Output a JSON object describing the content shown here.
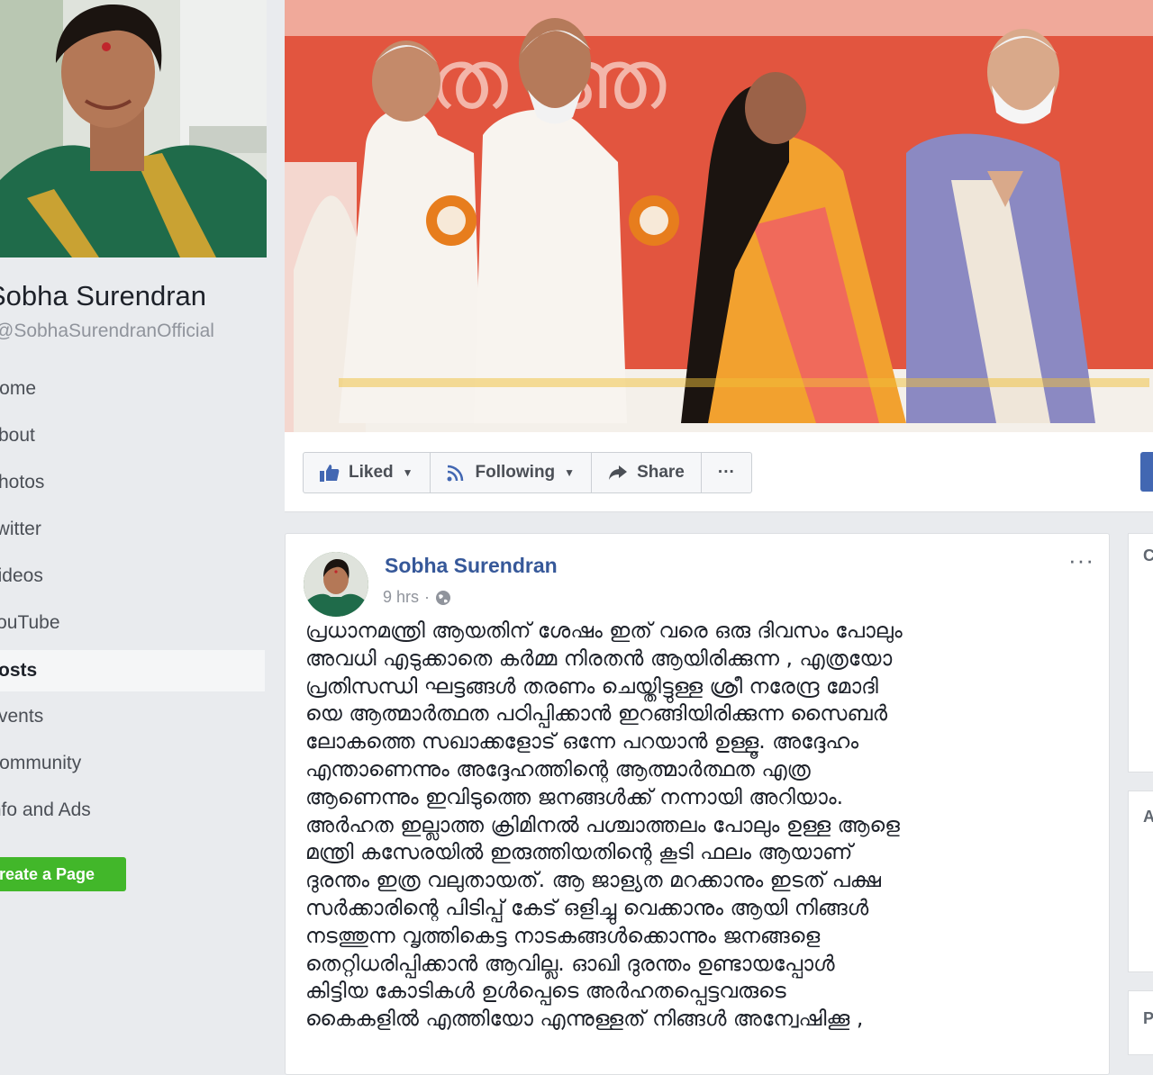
{
  "page": {
    "name": "Sobha Surendran",
    "handle": "@SobhaSurendranOfficial"
  },
  "nav": {
    "items": [
      "Home",
      "About",
      "Photos",
      "Twitter",
      "Videos",
      "YouTube",
      "Posts",
      "Events",
      "Community",
      "Info and Ads"
    ],
    "active_index": 6,
    "create_page": "Create a Page"
  },
  "actions": {
    "liked": "Liked",
    "following": "Following",
    "share": "Share",
    "more": "···"
  },
  "post": {
    "author": "Sobha Surendran",
    "time": "9 hrs",
    "menu": "···",
    "lines": [
      "പ്രധാനമന്ത്രി ആയതിന് ശേഷം ഇത് വരെ ഒരു ദിവസം പോലും",
      "അവധി എടുക്കാതെ കർമ്മ നിരതൻ ആയിരിക്കുന്ന , എത്രയോ",
      "പ്രതിസന്ധി ഘട്ടങ്ങൾ തരണം ചെയ്തിട്ടുള്ള ശ്രീ നരേന്ദ്ര മോദി",
      "യെ ആത്മാർത്ഥത പഠിപ്പിക്കാൻ ഇറങ്ങിയിരിക്കുന്ന സൈബർ",
      "ലോകത്തെ സഖാക്കളോട് ഒന്നേ പറയാൻ ഉള്ളൂ. അദ്ദേഹം",
      "എന്താണെന്നും അദ്ദേഹത്തിന്റെ ആത്മാർത്ഥത എത്ര",
      "ആണെന്നും ഇവിടുത്തെ ജനങ്ങൾക്ക് നന്നായി അറിയാം.",
      "അർഹത ഇല്ലാത്ത ക്രിമിനൽ പശ്ചാത്തലം പോലും ഉള്ള ആളെ",
      "മന്ത്രി കസേരയിൽ ഇരുത്തിയതിന്റെ കൂടി ഫലം ആയാണ്",
      "ദുരന്തം ഇത്ര വലുതായത്. ആ ജാള്യത മറക്കാനും ഇടത് പക്ഷ",
      "സർക്കാരിന്റെ പിടിപ്പ് കേട് ഒളിച്ചു വെക്കാനും ആയി നിങ്ങൾ",
      "നടത്തുന്ന വൃത്തികെട്ട നാടകങ്ങൾക്കൊന്നും ജനങ്ങളെ",
      "തെറ്റിധരിപ്പിക്കാൻ ആവില്ല. ഓഖി ദുരന്തം ഉണ്ടായപ്പോൾ",
      "കിട്ടിയ കോടികൾ ഉൾപ്പെടെ അർഹതപ്പെട്ടവരുടെ",
      "കൈകളിൽ എത്തിയോ എന്നുള്ളത് നിങ്ങൾ അന്വേഷിക്കൂ ,"
    ]
  },
  "colors": {
    "background": "#e9ebee",
    "link_blue": "#365899",
    "create_green": "#42b72a",
    "cover_banner": "#e5533f"
  }
}
